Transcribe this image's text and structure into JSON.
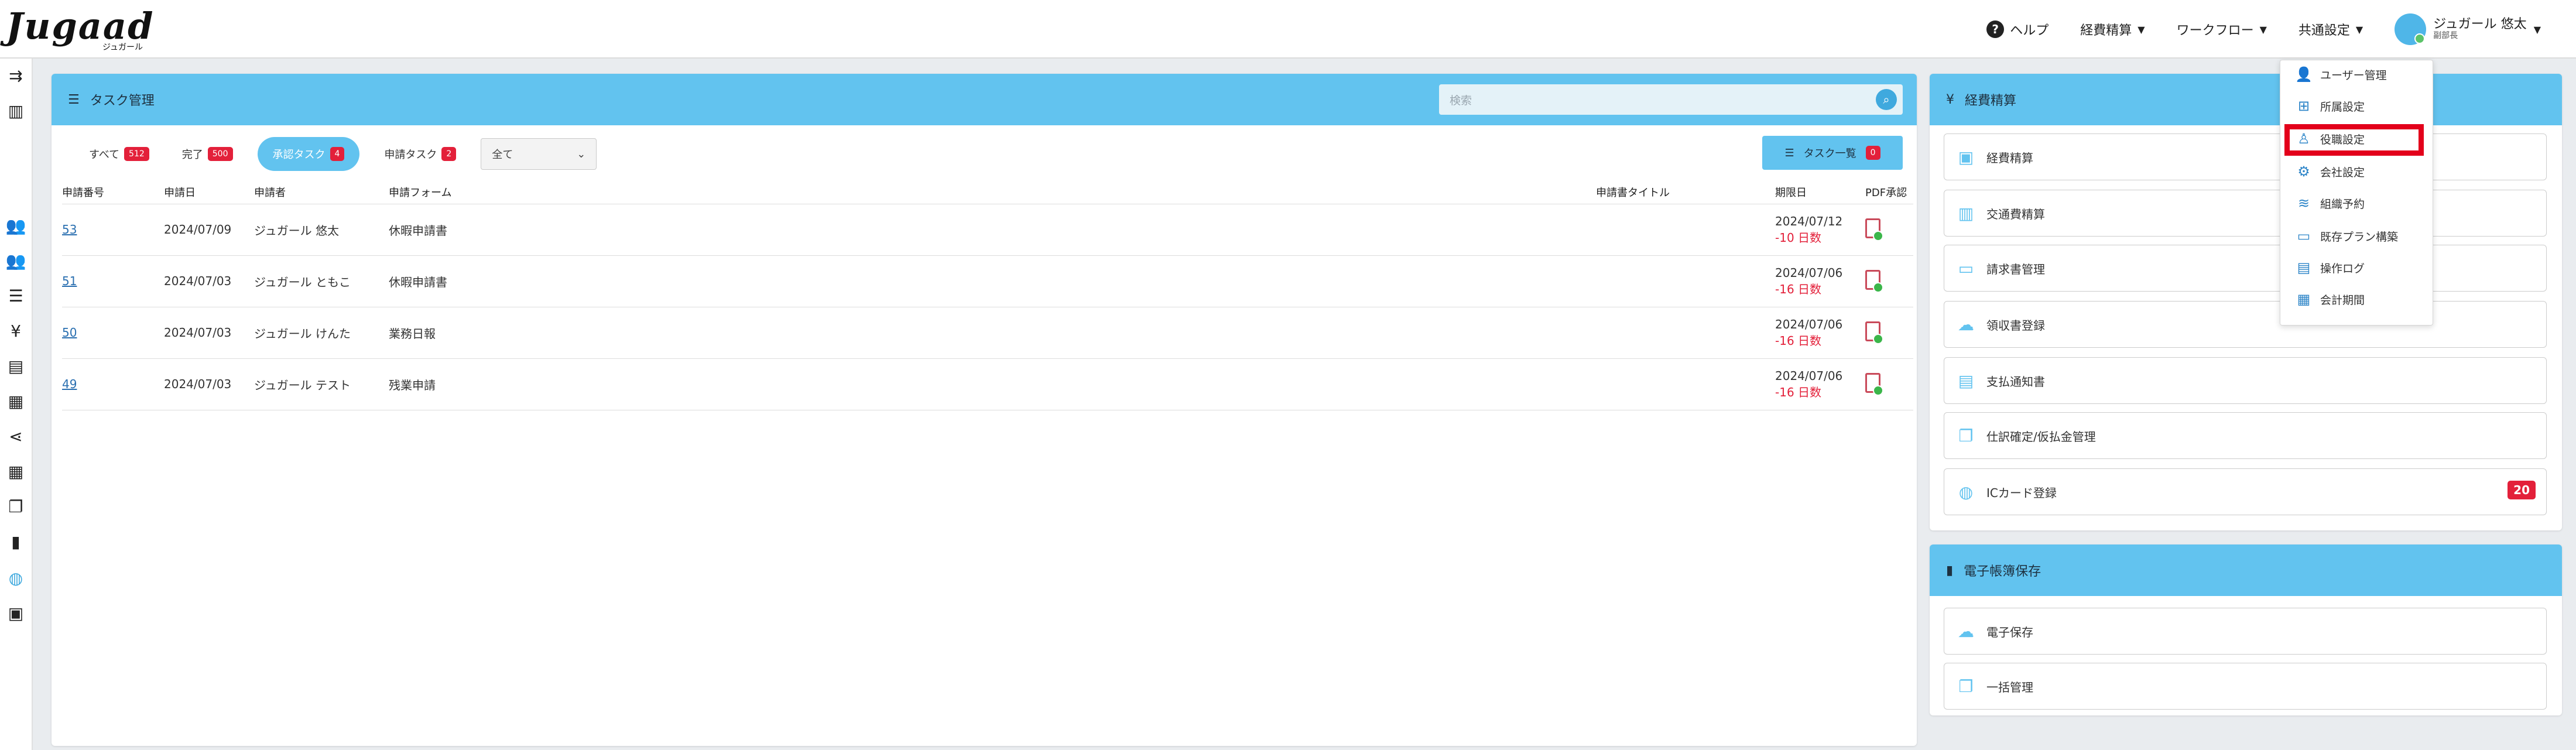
{
  "header": {
    "logo_text": "Jugaad",
    "logo_sub": "ジュガール",
    "nav": [
      {
        "label": "ヘルプ"
      },
      {
        "label": "経費精算"
      },
      {
        "label": "ワークフロー"
      },
      {
        "label": "共通設定"
      }
    ],
    "user": {
      "name": "ジュガール 悠太",
      "role": "副部長"
    }
  },
  "sidebar": {
    "icons": [
      "collapse-icon",
      "building-icon",
      "users-icon",
      "team-icon",
      "list-icon",
      "yen-icon",
      "document-list-icon",
      "receipt-icon",
      "share-icon",
      "table-icon",
      "copy-icon",
      "file-icon",
      "globe-icon",
      "wallet-icon"
    ]
  },
  "task_panel": {
    "title": "タスク管理",
    "search_placeholder": "検索",
    "tabs": [
      {
        "label": "すべて",
        "count": "512"
      },
      {
        "label": "完了",
        "count": "500"
      },
      {
        "label": "承認タスク",
        "count": "4"
      },
      {
        "label": "申請タスク",
        "count": "2"
      }
    ],
    "select_value": "全て",
    "list_button": "タスク一覧",
    "list_button_count": "0",
    "columns": {
      "number": "申請番号",
      "date": "申請日",
      "applicant": "申請者",
      "form": "申請フォーム",
      "title": "申請書タイトル",
      "due": "期限日",
      "pdf": "PDF承認"
    },
    "rows": [
      {
        "number": "53",
        "date": "2024/07/09",
        "applicant": "ジュガール 悠太",
        "form": "休暇申請書",
        "title": "",
        "due": "2024/07/12",
        "overdue": "-10 日数"
      },
      {
        "number": "51",
        "date": "2024/07/03",
        "applicant": "ジュガール ともこ",
        "form": "休暇申請書",
        "title": "",
        "due": "2024/07/06",
        "overdue": "-16 日数"
      },
      {
        "number": "50",
        "date": "2024/07/03",
        "applicant": "ジュガール けんた",
        "form": "業務日報",
        "title": "",
        "due": "2024/07/06",
        "overdue": "-16 日数"
      },
      {
        "number": "49",
        "date": "2024/07/03",
        "applicant": "ジュガール テスト",
        "form": "残業申請",
        "title": "",
        "due": "2024/07/06",
        "overdue": "-16 日数"
      }
    ]
  },
  "expense_panel": {
    "title": "経費精算",
    "items": [
      {
        "label": "経費精算",
        "icon": "camera-icon"
      },
      {
        "label": "交通費精算",
        "icon": "train-icon"
      },
      {
        "label": "請求書管理",
        "icon": "card-icon"
      },
      {
        "label": "領収書登録",
        "icon": "cloud-upload-icon"
      },
      {
        "label": "支払通知書",
        "icon": "receipt-icon"
      },
      {
        "label": "仕訳確定/仮払金管理",
        "icon": "copy-icon"
      },
      {
        "label": "ICカード登録",
        "icon": "globe-icon",
        "count": "20"
      }
    ]
  },
  "ebook_panel": {
    "title": "電子帳簿保存",
    "items": [
      {
        "label": "電子保存",
        "icon": "cloud-upload-icon"
      },
      {
        "label": "一括管理",
        "icon": "copy-icon"
      }
    ]
  },
  "settings_dropdown": {
    "items": [
      {
        "label": "ユーザー管理"
      },
      {
        "label": "所属設定"
      },
      {
        "label": "役職設定"
      },
      {
        "label": "会社設定"
      },
      {
        "label": "組織予約"
      },
      {
        "label": "既存プラン構築"
      },
      {
        "label": "操作ログ"
      },
      {
        "label": "会計期間"
      }
    ],
    "highlighted": "役職設定"
  },
  "colors": {
    "accent": "#62c3ef",
    "badge": "#e3203a",
    "highlight": "#e3001b",
    "link": "#2a6fb0"
  }
}
